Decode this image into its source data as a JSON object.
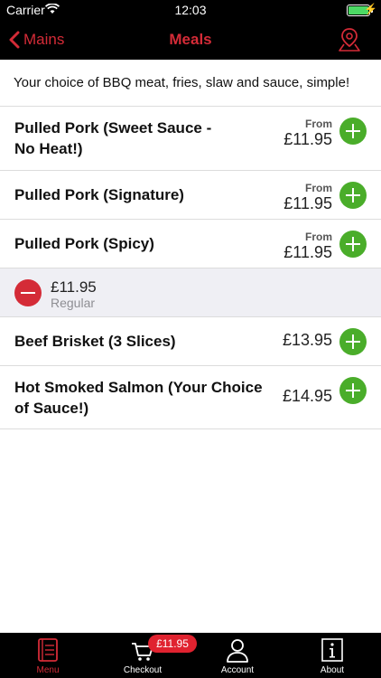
{
  "status_bar": {
    "carrier": "Carrier",
    "time": "12:03",
    "battery_color": "#4cd964"
  },
  "nav": {
    "back_label": "Mains",
    "title": "Meals",
    "right_icon": "map-pin-icon",
    "accent_color": "#d42b37"
  },
  "description": "Your choice of BBQ meat, fries, slaw and sauce, simple!",
  "items": [
    {
      "name_line1": "Pulled Pork (Sweet Sauce -",
      "name_line2": "No Heat!)",
      "from": "From",
      "price": "£11.95"
    },
    {
      "name": "Pulled Pork (Signature)",
      "from": "From",
      "price": "£11.95"
    },
    {
      "name": "Pulled Pork (Spicy)",
      "from": "From",
      "price": "£11.95"
    },
    {
      "name": "Beef Brisket (3 Slices)",
      "price": "£13.95"
    },
    {
      "name_line1": "Hot Smoked Salmon (Your Choice",
      "name_line2": "of Sauce!)",
      "price": "£14.95"
    }
  ],
  "selected_variant": {
    "price": "£11.95",
    "size": "Regular"
  },
  "tabs": [
    {
      "label": "Menu",
      "icon": "menu-book-icon",
      "active": true
    },
    {
      "label": "Checkout",
      "icon": "cart-icon",
      "active": false
    },
    {
      "label": "Account",
      "icon": "user-icon",
      "active": false
    },
    {
      "label": "About",
      "icon": "info-icon",
      "active": false
    }
  ],
  "checkout_badge": "£11.95",
  "colors": {
    "add_button": "#4aad2a",
    "remove_button": "#d42b37",
    "badge": "#e0222f"
  }
}
